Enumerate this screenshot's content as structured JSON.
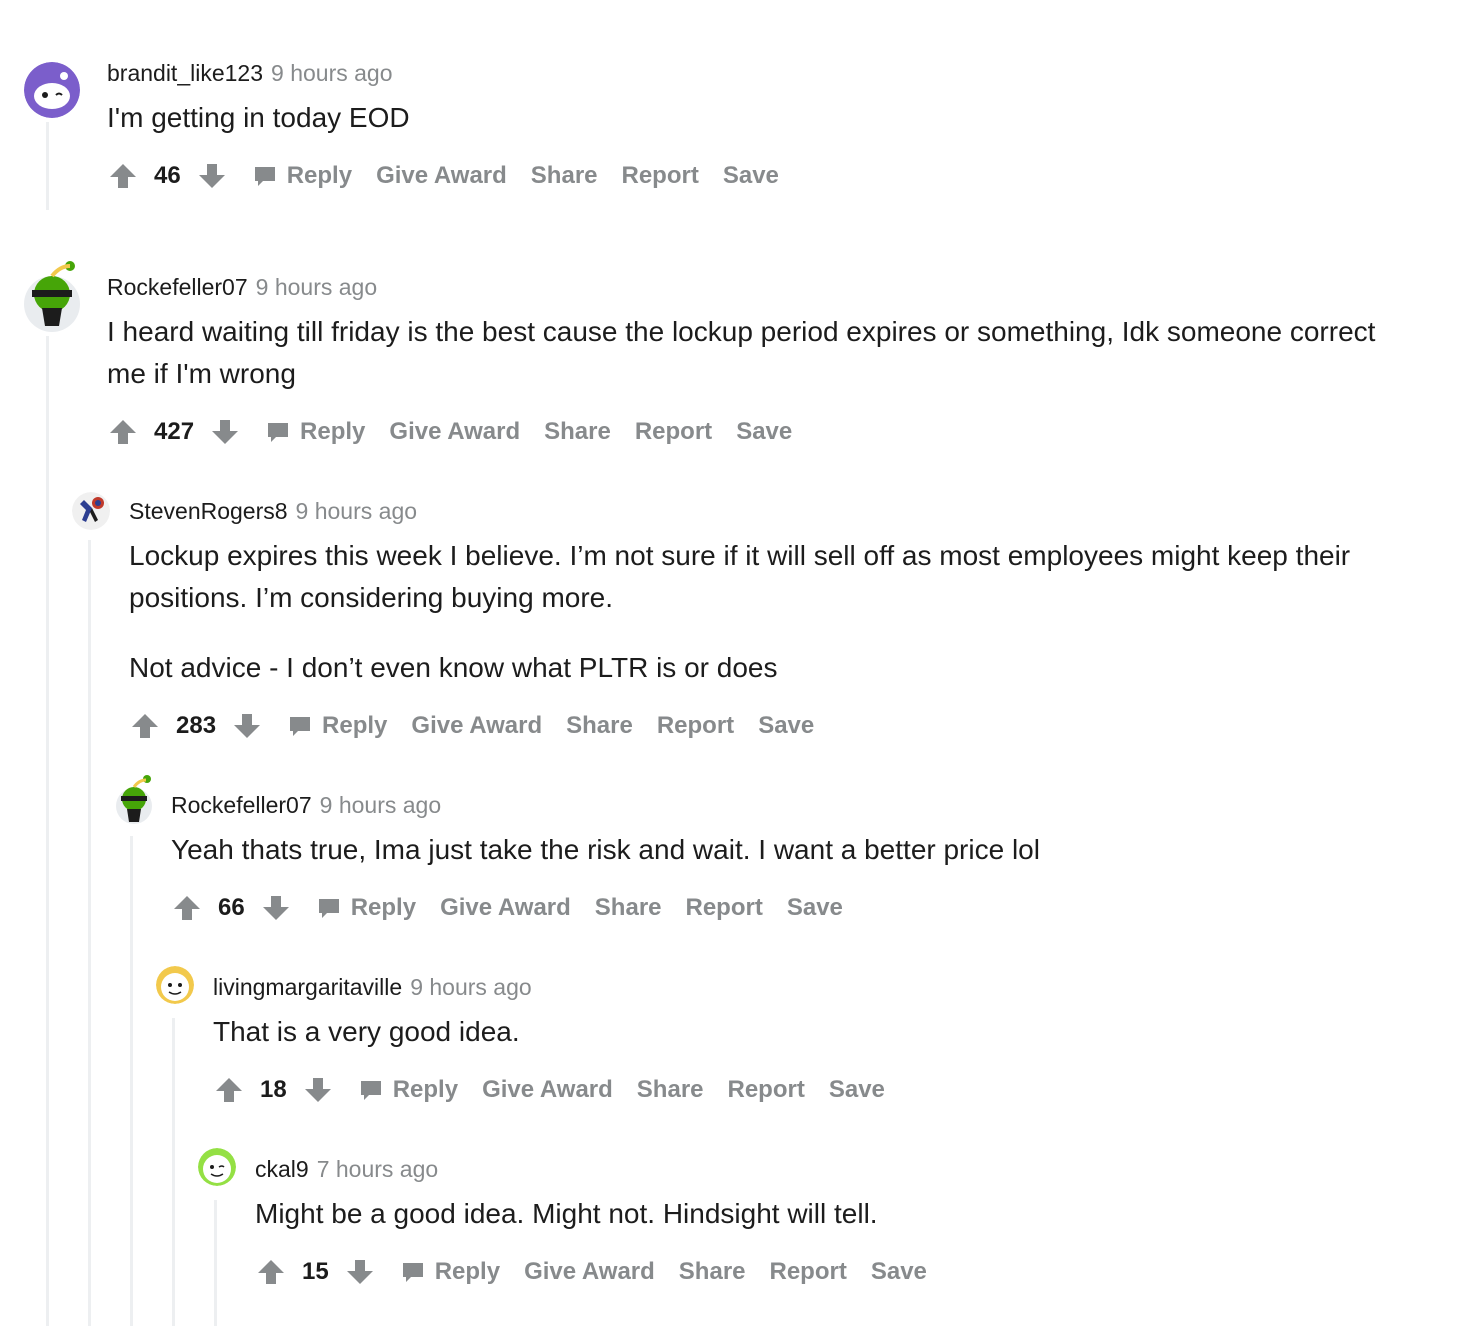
{
  "comments": [
    {
      "username": "brandit_like123",
      "time": "9 hours ago",
      "body": [
        "I'm getting in today EOD"
      ],
      "score": "46",
      "avatar_color": "#7b5ecb"
    },
    {
      "username": "Rockefeller07",
      "time": "9 hours ago",
      "body": [
        "I heard waiting till friday is the best cause the lockup period expires or something, Idk someone correct me if I'm wrong"
      ],
      "score": "427",
      "avatar_color": "#46a508"
    },
    {
      "username": "StevenRogers8",
      "time": "9 hours ago",
      "body": [
        "Lockup expires this week I believe. I’m not sure if it will sell off as most employees might keep their positions. I’m considering buying more.",
        "Not advice - I don’t even know what PLTR is or does"
      ],
      "score": "283",
      "avatar_color": "#1c1c1c"
    },
    {
      "username": "Rockefeller07",
      "time": "9 hours ago",
      "body": [
        "Yeah thats true, Ima just take the risk and wait. I want a better price lol"
      ],
      "score": "66",
      "avatar_color": "#46a508"
    },
    {
      "username": "livingmargaritaville",
      "time": "9 hours ago",
      "body": [
        "That is a very good idea."
      ],
      "score": "18",
      "avatar_color": "#f2c94c"
    },
    {
      "username": "ckal9",
      "time": "7 hours ago",
      "body": [
        "Might be a good idea. Might not. Hindsight will tell."
      ],
      "score": "15",
      "avatar_color": "#94e044"
    }
  ],
  "actions": {
    "reply": "Reply",
    "give_award": "Give Award",
    "share": "Share",
    "report": "Report",
    "save": "Save"
  },
  "icons": {
    "upvote": "upvote-arrow-icon",
    "downvote": "downvote-arrow-icon",
    "reply": "speech-bubble-icon"
  },
  "colors": {
    "meta_gray": "#878a8c",
    "text": "#1c1c1c",
    "thread_line": "#edeff1"
  }
}
